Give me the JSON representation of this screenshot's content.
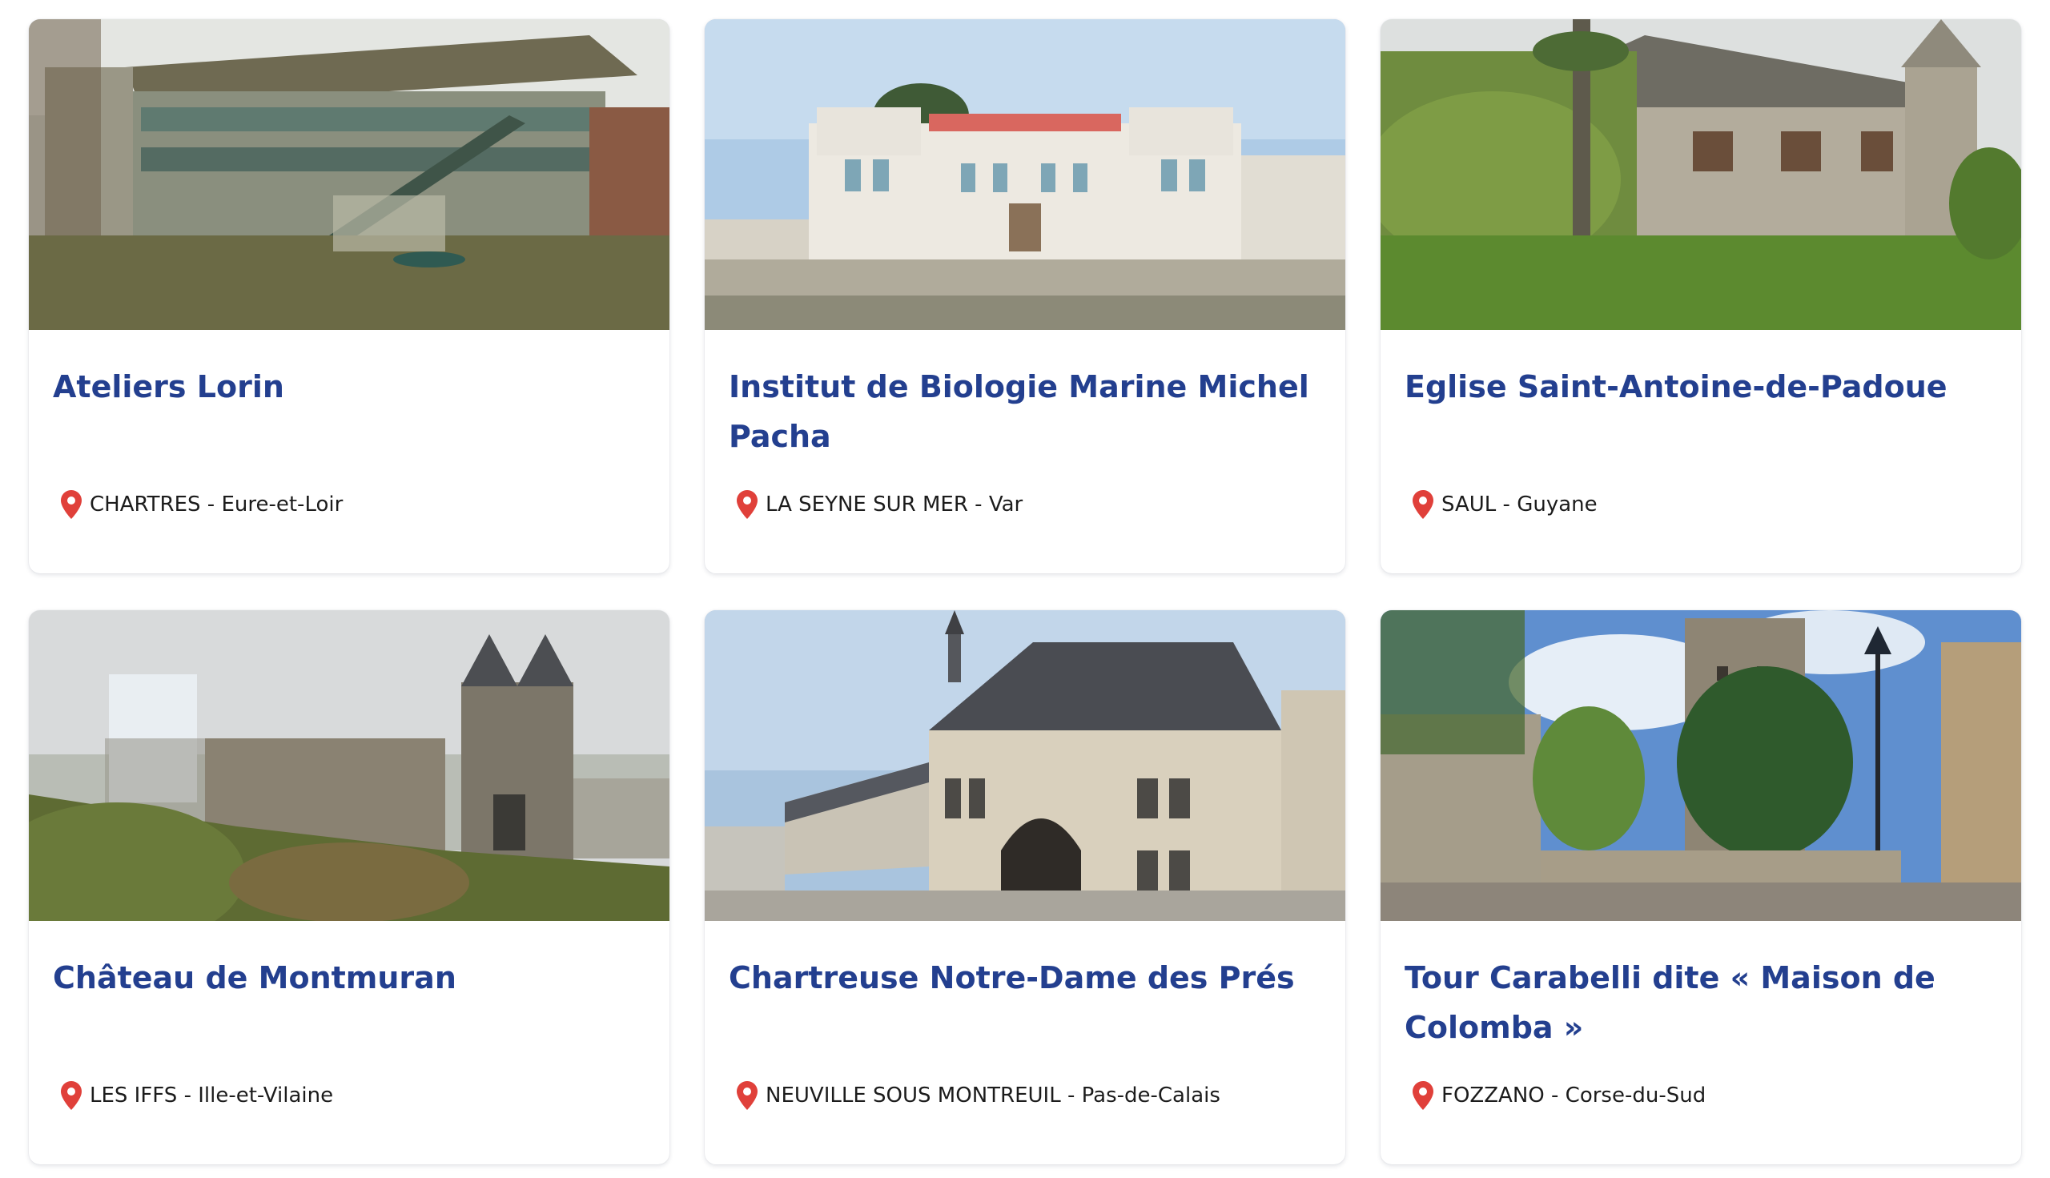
{
  "cards": [
    {
      "title": "Ateliers Lorin",
      "city": "CHARTRES",
      "separator": " - ",
      "department": "Eure-et-Loir",
      "image": "photo-ateliers-lorin",
      "icon": "map-pin-icon"
    },
    {
      "title": "Institut de Biologie Marine Michel Pacha",
      "city": "LA SEYNE SUR MER",
      "separator": " - ",
      "department": "Var",
      "image": "photo-institut-biologie-marine",
      "icon": "map-pin-icon"
    },
    {
      "title": "Eglise Saint-Antoine-de-Padoue",
      "city": "SAUL",
      "separator": " - ",
      "department": "Guyane",
      "image": "photo-eglise-saint-antoine",
      "icon": "map-pin-icon"
    },
    {
      "title": "Château de Montmuran",
      "city": "LES IFFS",
      "separator": " - ",
      "department": "Ille-et-Vilaine",
      "image": "photo-chateau-montmuran",
      "icon": "map-pin-icon"
    },
    {
      "title": "Chartreuse Notre-Dame des Prés",
      "city": "NEUVILLE SOUS MONTREUIL",
      "separator": " - ",
      "department": "Pas-de-Calais",
      "image": "photo-chartreuse-notre-dame",
      "icon": "map-pin-icon"
    },
    {
      "title": "Tour Carabelli dite « Maison de Colomba »",
      "city": "FOZZANO",
      "separator": " - ",
      "department": "Corse-du-Sud",
      "image": "photo-tour-carabelli",
      "icon": "map-pin-icon"
    }
  ],
  "colors": {
    "title": "#233f8f",
    "pin": "#e0403a",
    "text": "#1c1c1c",
    "card_bg": "#ffffff"
  }
}
